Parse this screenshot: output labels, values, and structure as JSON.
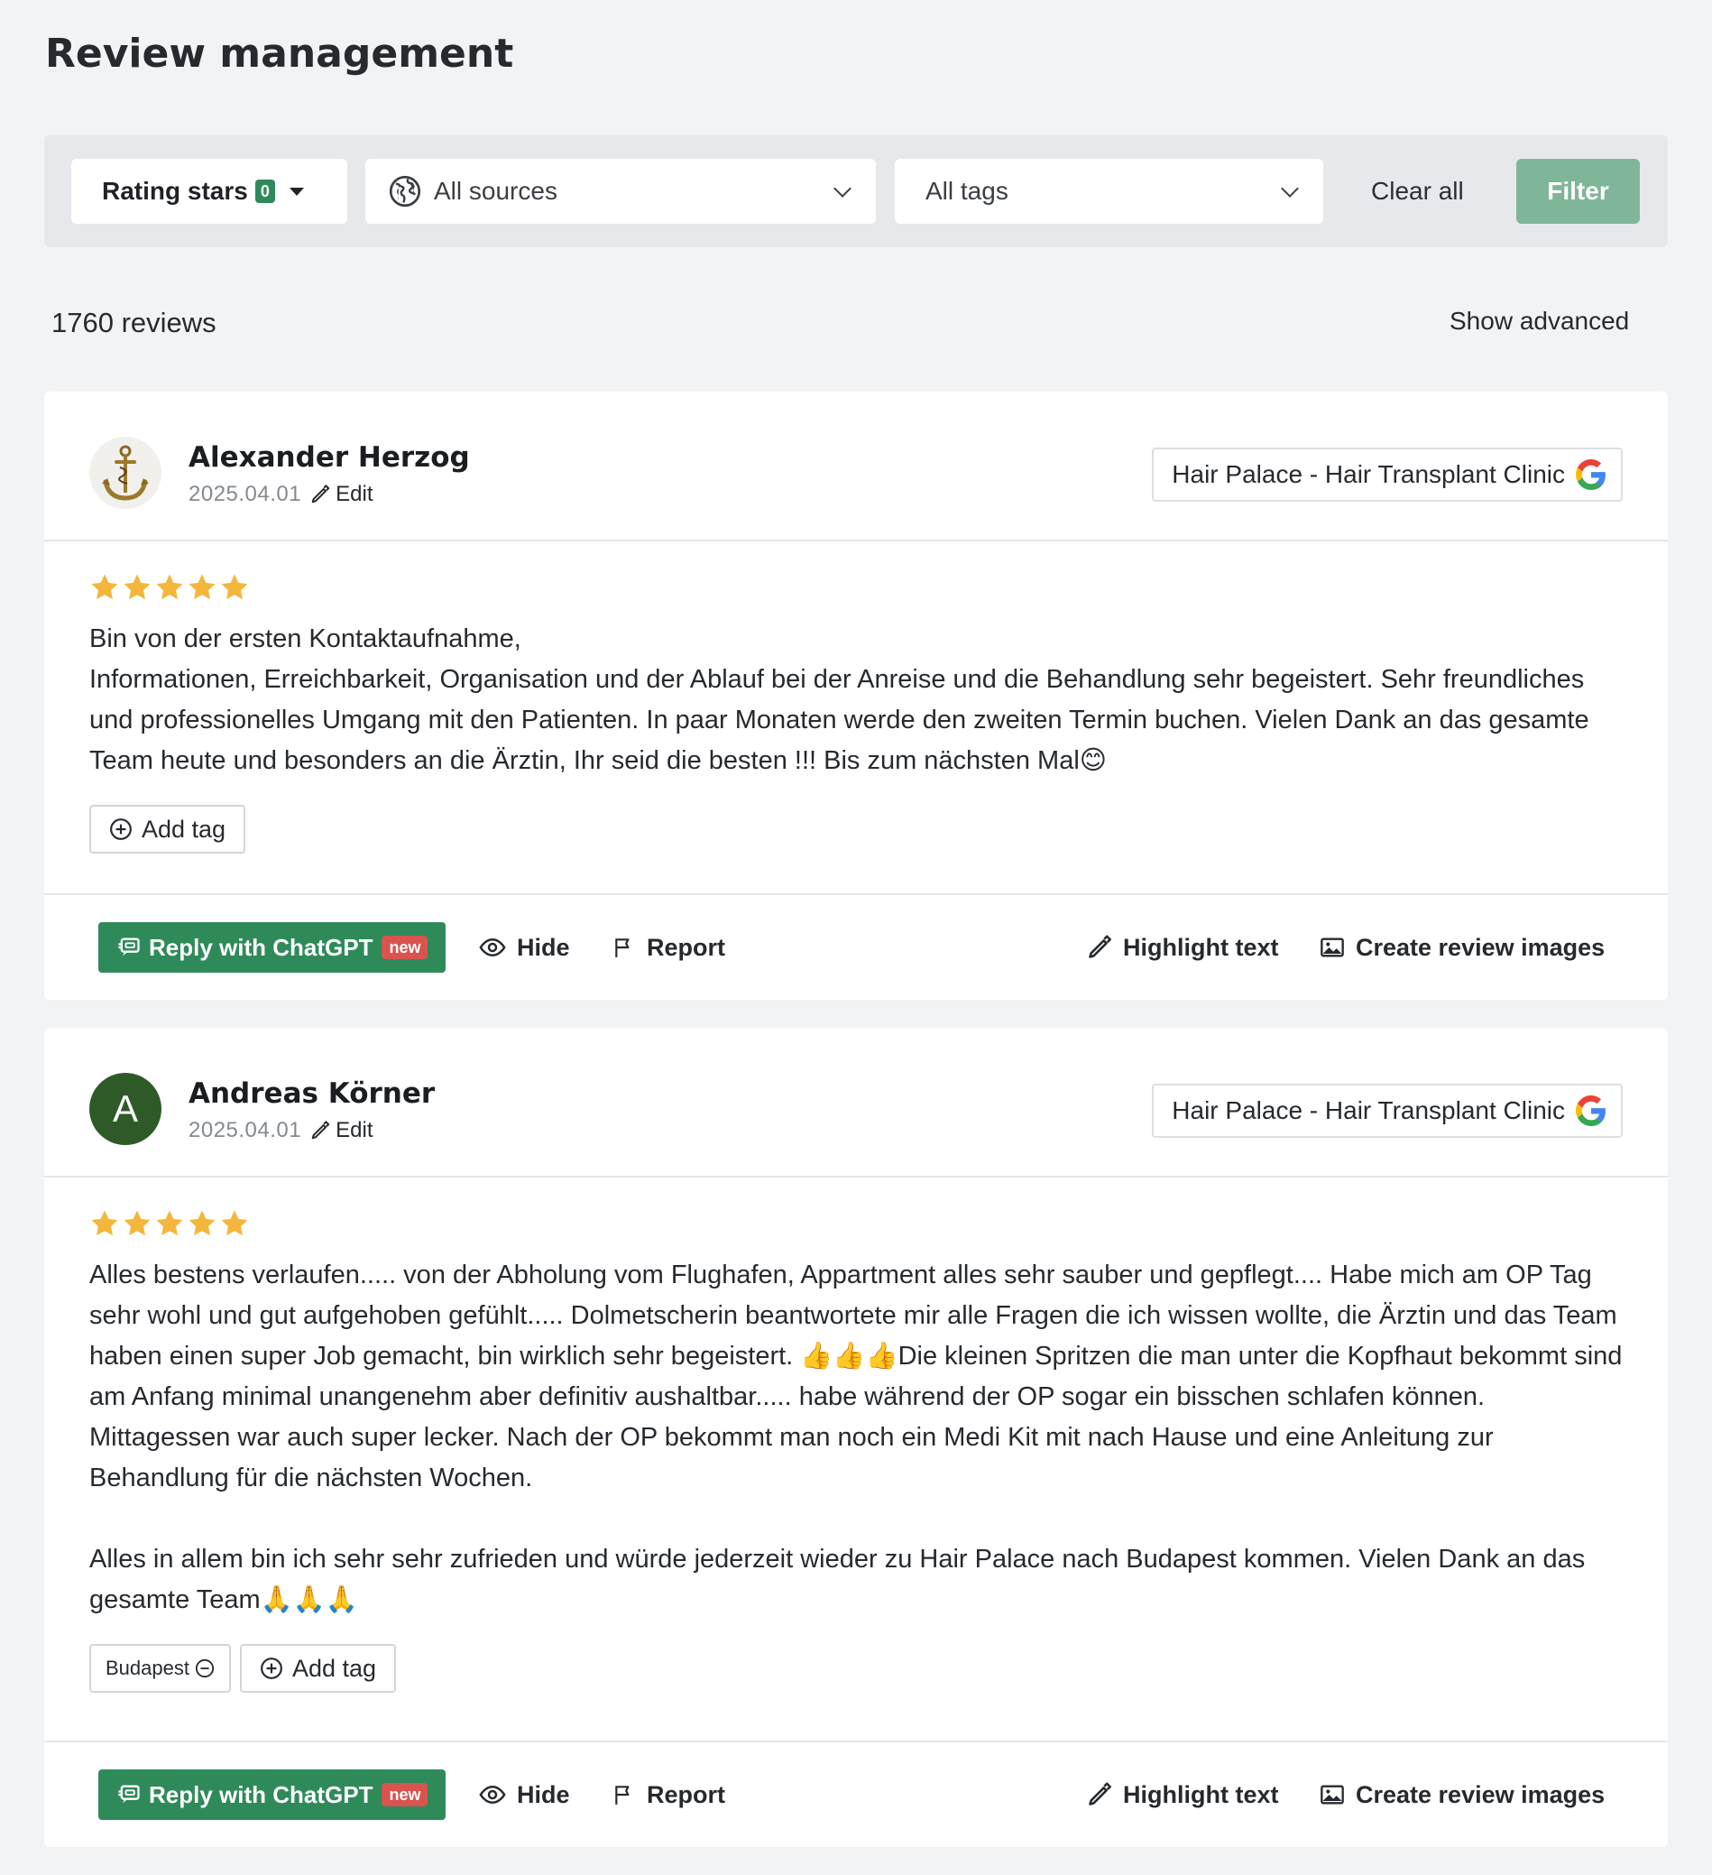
{
  "page_title": "Review management",
  "filters": {
    "rating_label": "Rating stars",
    "rating_count": "0",
    "sources_value": "All sources",
    "tags_value": "All tags",
    "clear_all": "Clear all",
    "filter": "Filter"
  },
  "summary": {
    "review_count": "1760 reviews",
    "show_advanced": "Show advanced"
  },
  "accent_color": "#2f8a5a",
  "star_color": "#f4b73b",
  "reviews": [
    {
      "author": "Alexander Herzog",
      "date": "2025.04.01",
      "edit_label": "Edit",
      "avatar": "anchor-image",
      "source": "Hair Palace - Hair Transplant Clinic",
      "source_icon": "google-icon",
      "rating": 5,
      "text": "Bin von der ersten Kontaktaufnahme,\nInformationen, Erreichbarkeit, Organisation und der Ablauf bei der Anreise und die Behandlung sehr begeistert. Sehr freundliches und professionelles Umgang mit den Patienten. In paar Monaten werde den zweiten Termin buchen. Vielen Dank an das gesamte Team heute und besonders an die Ärztin, Ihr seid die besten !!! Bis zum nächsten Mal😊",
      "tags": [],
      "add_tag": "Add tag"
    },
    {
      "author": "Andreas Körner",
      "date": "2025.04.01",
      "edit_label": "Edit",
      "avatar_letter": "A",
      "source": "Hair Palace - Hair Transplant Clinic",
      "source_icon": "google-icon",
      "rating": 5,
      "text": "Alles bestens verlaufen..... von der Abholung vom Flughafen, Appartment alles sehr sauber und gepflegt.... Habe mich am OP Tag sehr wohl und gut aufgehoben gefühlt..... Dolmetscherin beantwortete mir alle Fragen die ich wissen wollte, die Ärztin und das Team haben einen super Job gemacht, bin wirklich sehr begeistert. 👍👍👍Die kleinen Spritzen die man unter die Kopfhaut bekommt sind am Anfang minimal unangenehm aber definitiv aushaltbar..... habe während der OP sogar ein bisschen schlafen können. Mittagessen war auch super lecker. Nach der OP bekommt man noch ein Medi Kit mit nach Hause und eine Anleitung zur Behandlung für die nächsten Wochen.\n\nAlles in allem bin ich sehr sehr zufrieden und würde jederzeit wieder zu Hair Palace nach Budapest kommen. Vielen Dank an das gesamte Team🙏🙏🙏",
      "tags": [
        "Budapest"
      ],
      "add_tag": "Add tag"
    }
  ],
  "actions": {
    "reply_gpt": "Reply with ChatGPT",
    "new_badge": "new",
    "hide": "Hide",
    "report": "Report",
    "highlight": "Highlight text",
    "create_images": "Create review images"
  }
}
